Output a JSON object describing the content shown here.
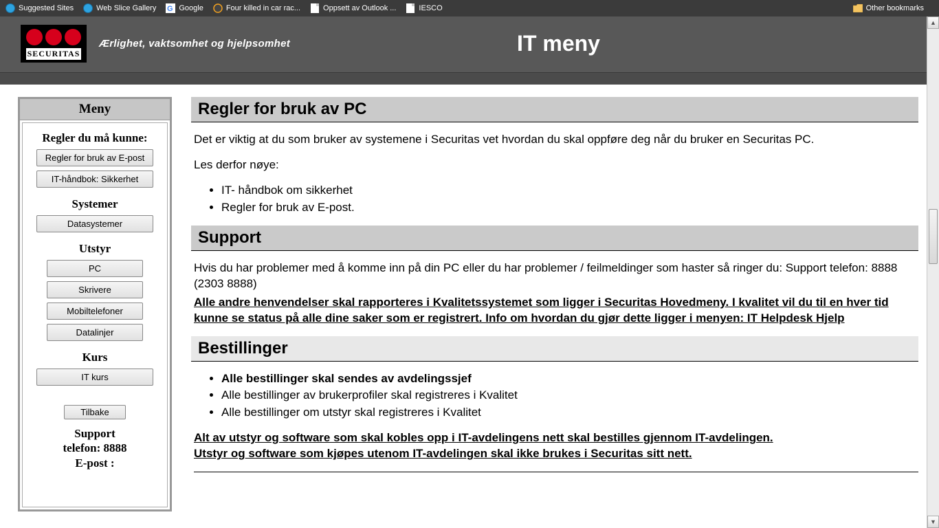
{
  "bookmarks": {
    "items": [
      {
        "label": "Suggested Sites",
        "icon": "ie"
      },
      {
        "label": "Web Slice Gallery",
        "icon": "ie"
      },
      {
        "label": "Google",
        "icon": "google"
      },
      {
        "label": "Four killed in car rac...",
        "icon": "dot"
      },
      {
        "label": "Oppsett av Outlook ...",
        "icon": "page"
      },
      {
        "label": "IESCO",
        "icon": "page"
      }
    ],
    "other": "Other bookmarks"
  },
  "header": {
    "brand": "SECURITAS",
    "tagline": "Ærlighet, vaktsomhet og hjelpsomhet",
    "title": "IT meny"
  },
  "sidebar": {
    "title": "Meny",
    "sections": [
      {
        "heading": "Regler du må kunne:",
        "buttons": [
          "Regler for bruk av E-post",
          "IT-håndbok: Sikkerhet"
        ]
      },
      {
        "heading": "Systemer",
        "buttons": [
          "Datasystemer"
        ]
      },
      {
        "heading": "Utstyr",
        "buttons": [
          "PC",
          "Skrivere",
          "Mobiltelefoner",
          "Datalinjer"
        ]
      },
      {
        "heading": "Kurs",
        "buttons": [
          "IT kurs"
        ]
      }
    ],
    "back": "Tilbake",
    "support": {
      "line1": "Support",
      "line2": "telefon:  8888",
      "line3": "E-post :"
    }
  },
  "main": {
    "s1": {
      "title": "Regler for bruk av PC",
      "p1": "Det er viktig at du som bruker av systemene i Securitas vet hvordan du skal oppføre deg når du bruker en Securitas PC.",
      "p2": "Les derfor nøye:",
      "bul": [
        "IT- håndbok om sikkerhet",
        "Regler for bruk av E-post."
      ]
    },
    "s2": {
      "title": "Support",
      "p1": "Hvis du har problemer med å komme inn på din PC eller du har problemer / feilmeldinger som haster så ringer du: Support telefon: 8888 (2303 8888)",
      "link": "Alle andre henvendelser skal rapporteres i Kvalitetssystemet som ligger i Securitas Hovedmeny. I kvalitet vil du til en hver tid kunne se status på alle dine saker som er registrert. Info om hvordan du gjør dette ligger i menyen: IT Helpdesk Hjelp"
    },
    "s3": {
      "title": "Bestillinger",
      "bul": [
        {
          "text": "Alle bestillinger skal sendes av avdelingssjef",
          "bold": true
        },
        {
          "text": "Alle bestillinger av brukerprofiler skal registreres i Kvalitet",
          "bold": false
        },
        {
          "text": "Alle bestillinger om utstyr skal registreres i Kvalitet",
          "bold": false
        }
      ],
      "link1": "Alt av utstyr og software som skal kobles opp i IT-avdelingens nett skal bestilles gjennom IT-avdelingen. ",
      "link2": "Utstyr og software som kjøpes utenom IT-avdelingen skal ikke brukes i Securitas sitt nett."
    }
  }
}
